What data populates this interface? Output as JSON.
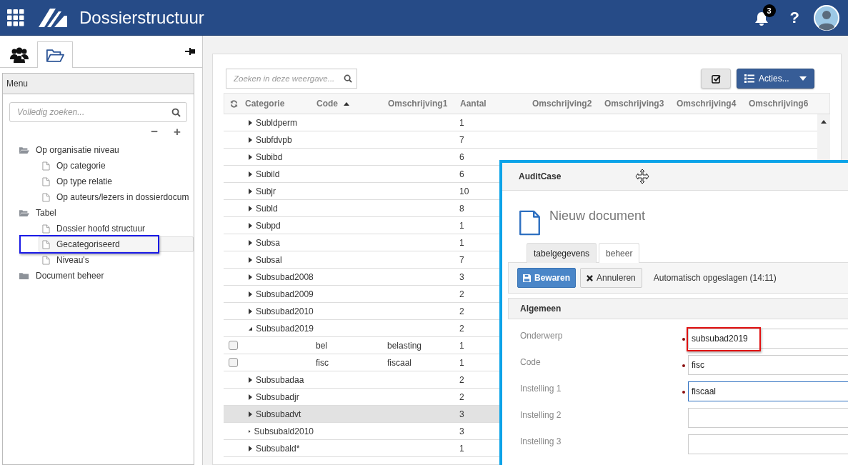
{
  "app": {
    "title": "Dossierstructuur",
    "notification_count": "3",
    "help": "?"
  },
  "sidebar": {
    "tabs": [
      {
        "kind": "people",
        "selected": false
      },
      {
        "kind": "folder",
        "selected": true
      }
    ],
    "menu_title": "Menu",
    "search": {
      "placeholder": "Volledig zoeken..."
    },
    "collapse_all": "−",
    "expand_all": "+",
    "tree": [
      {
        "label": "Op organisatie niveau",
        "kind": "folder",
        "expanded": true,
        "selected": false,
        "children": [
          {
            "label": "Op categorie",
            "kind": "page",
            "selected": false
          },
          {
            "label": "Op type relatie",
            "kind": "page",
            "selected": false
          },
          {
            "label": "Op auteurs/lezers in dossierdocum",
            "kind": "page",
            "selected": false
          }
        ]
      },
      {
        "label": "Tabel",
        "kind": "folder",
        "expanded": true,
        "selected": false,
        "children": [
          {
            "label": "Dossier hoofd structuur",
            "kind": "page",
            "selected": false
          },
          {
            "label": "Gecategoriseerd",
            "kind": "page",
            "selected": true,
            "annotated": true
          },
          {
            "label": "Niveau's",
            "kind": "page",
            "selected": false
          }
        ]
      },
      {
        "label": "Document beheer",
        "kind": "folder",
        "expanded": false,
        "selected": false
      }
    ]
  },
  "table": {
    "search": {
      "placeholder": "Zoeken in deze weergave..."
    },
    "actions": "Acties...",
    "columns": [
      {
        "label": "Categorie",
        "sorted": false
      },
      {
        "label": "Code",
        "sorted": true
      },
      {
        "label": "Omschrijving1",
        "sorted": false
      },
      {
        "label": "Aantal",
        "sorted": false
      },
      {
        "label": "Omschrijving2",
        "sorted": false
      },
      {
        "label": "Omschrijving3",
        "sorted": false
      },
      {
        "label": "Omschrijving4",
        "sorted": false
      },
      {
        "label": "Omschrijving6",
        "sorted": false
      }
    ],
    "rows": [
      {
        "kind": "group",
        "category": "Subldperm",
        "count": "1",
        "expanded": false,
        "highlighted": false
      },
      {
        "kind": "group",
        "category": "Subfdvpb",
        "count": "7",
        "expanded": false,
        "highlighted": false
      },
      {
        "kind": "group",
        "category": "Subibd",
        "count": "6",
        "expanded": false,
        "highlighted": false
      },
      {
        "kind": "group",
        "category": "Subild",
        "count": "6",
        "expanded": false,
        "highlighted": false
      },
      {
        "kind": "group",
        "category": "Subjr",
        "count": "10",
        "expanded": false,
        "highlighted": false
      },
      {
        "kind": "group",
        "category": "Subld",
        "count": "8",
        "expanded": false,
        "highlighted": false
      },
      {
        "kind": "group",
        "category": "Subpd",
        "count": "1",
        "expanded": false,
        "highlighted": false
      },
      {
        "kind": "group",
        "category": "Subsa",
        "count": "1",
        "expanded": false,
        "highlighted": false
      },
      {
        "kind": "group",
        "category": "Subsal",
        "count": "7",
        "expanded": false,
        "highlighted": false
      },
      {
        "kind": "group",
        "category": "Subsubad2008",
        "count": "3",
        "expanded": false,
        "highlighted": false
      },
      {
        "kind": "group",
        "category": "Subsubad2009",
        "count": "2",
        "expanded": false,
        "highlighted": false
      },
      {
        "kind": "group",
        "category": "Subsubad2010",
        "count": "2",
        "expanded": false,
        "highlighted": false
      },
      {
        "kind": "group",
        "category": "Subsubad2019",
        "count": "2",
        "expanded": true,
        "highlighted": false
      },
      {
        "kind": "item",
        "code": "bel",
        "description": "belasting",
        "count": "1",
        "checked": false,
        "highlighted": false
      },
      {
        "kind": "item",
        "code": "fisc",
        "description": "fiscaal",
        "count": "1",
        "checked": false,
        "highlighted": false
      },
      {
        "kind": "group",
        "category": "Subsubadaa",
        "count": "2",
        "expanded": false,
        "highlighted": false
      },
      {
        "kind": "group",
        "category": "Subsubadjr",
        "count": "2",
        "expanded": false,
        "highlighted": false
      },
      {
        "kind": "group",
        "category": "Subsubadvt",
        "count": "3",
        "expanded": false,
        "highlighted": true
      },
      {
        "kind": "group",
        "category": "Subsubald2010",
        "count": "3",
        "expanded": false,
        "highlighted": false
      },
      {
        "kind": "group",
        "category": "Subsubald*",
        "count": "1",
        "expanded": false,
        "highlighted": false
      }
    ]
  },
  "dialog": {
    "title": "AuditCase",
    "heading": "Nieuw document",
    "tabs": [
      {
        "label": "tabelgegevens",
        "selected": true
      },
      {
        "label": "beheer",
        "selected": false
      }
    ],
    "save": "Bewaren",
    "cancel": "Annuleren",
    "autosave": "Automatisch opgeslagen (14:11)",
    "section": "Algemeen",
    "fields": [
      {
        "label": "Onderwerp",
        "value": "subsubad2019",
        "required": true,
        "focused": false,
        "annotated": true
      },
      {
        "label": "Code",
        "value": "fisc",
        "required": true,
        "focused": false
      },
      {
        "label": "Instelling 1",
        "value": "fiscaal",
        "required": true,
        "focused": true
      },
      {
        "label": "Instelling 2",
        "required": false,
        "focused": false
      },
      {
        "label": "Instelling 3",
        "required": false,
        "focused": false
      }
    ]
  }
}
